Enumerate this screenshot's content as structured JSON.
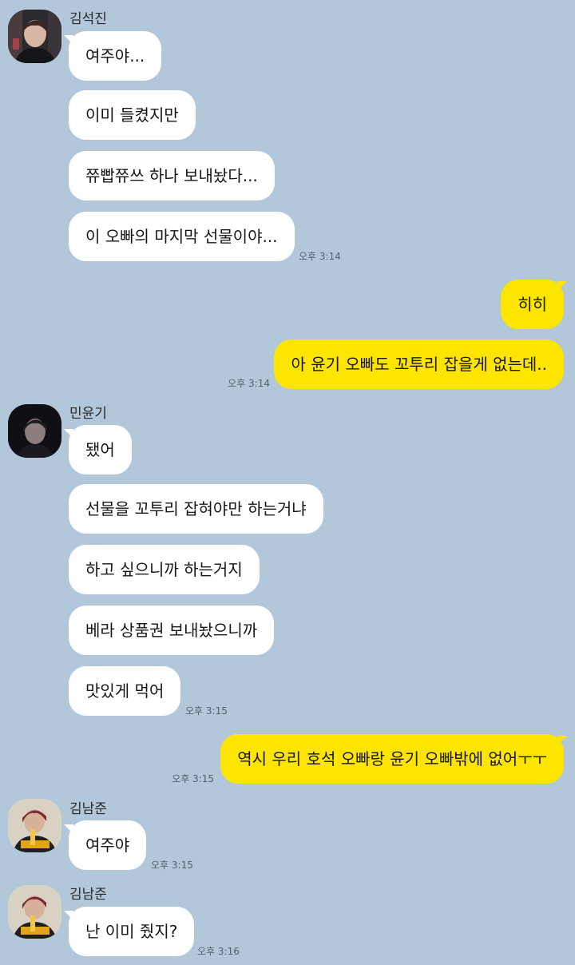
{
  "colors": {
    "background": "#b2c7da",
    "incoming_bubble": "#ffffff",
    "outgoing_bubble": "#fee500",
    "timestamp": "#56606b"
  },
  "groups": [
    {
      "sender": "김석진",
      "avatar_icon": "profile-photo-icon",
      "messages": [
        "여주야...",
        "이미 들켰지만",
        "쮸빱쮸쓰 하나 보내놨다...",
        "이 오빠의 마지막 선물이야..."
      ],
      "time": "오후 3:14"
    },
    {
      "sender": "me",
      "messages": [
        "히히",
        "아 윤기 오빠도 꼬투리 잡을게 없는데.."
      ],
      "time": "오후 3:14"
    },
    {
      "sender": "민윤기",
      "avatar_icon": "profile-photo-icon",
      "messages": [
        "됐어",
        "선물을 꼬투리 잡혀야만 하는거냐",
        "하고 싶으니까 하는거지",
        "베라 상품권 보내놨으니까",
        "맛있게 먹어"
      ],
      "time": "오후 3:15"
    },
    {
      "sender": "me",
      "messages": [
        "역시 우리 호석 오빠랑 윤기 오빠밖에 없어ㅜㅜ"
      ],
      "time": "오후 3:15"
    },
    {
      "sender": "김남준",
      "avatar_icon": "profile-photo-icon",
      "messages": [
        "여주야"
      ],
      "time": "오후 3:15"
    },
    {
      "sender": "김남준",
      "avatar_icon": "profile-photo-icon",
      "messages": [
        "난 이미 줬지?"
      ],
      "time": "오후 3:16"
    }
  ]
}
